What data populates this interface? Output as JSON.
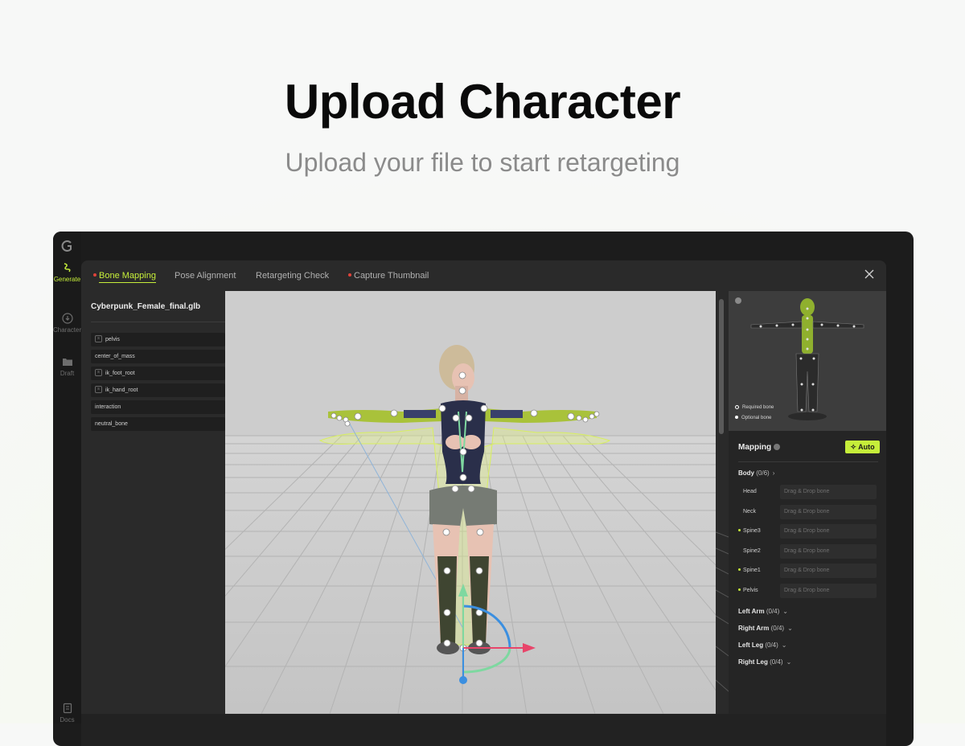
{
  "hero": {
    "title": "Upload Character",
    "subtitle": "Upload your file to start retargeting"
  },
  "sidebar": {
    "items": [
      {
        "label": "Generate",
        "icon": "squiggle-icon",
        "active": true
      },
      {
        "label": "Character",
        "icon": "download-circle-icon",
        "active": false
      },
      {
        "label": "Draft",
        "icon": "folder-icon",
        "active": false
      },
      {
        "label": "Docs",
        "icon": "document-icon",
        "active": false
      }
    ]
  },
  "tabs": [
    {
      "label": "Bone Mapping",
      "active": true,
      "alert": true
    },
    {
      "label": "Pose Alignment",
      "active": false,
      "alert": false
    },
    {
      "label": "Retargeting Check",
      "active": false,
      "alert": false
    },
    {
      "label": "Capture Thumbnail",
      "active": false,
      "alert": true
    }
  ],
  "file": {
    "name": "Cyberpunk_Female_final.glb",
    "bones": [
      {
        "label": "pelvis",
        "has_icon": true
      },
      {
        "label": "center_of_mass",
        "has_icon": false
      },
      {
        "label": "ik_foot_root",
        "has_icon": true
      },
      {
        "label": "ik_hand_root",
        "has_icon": true
      },
      {
        "label": "interaction",
        "has_icon": false
      },
      {
        "label": "neutral_bone",
        "has_icon": false
      }
    ]
  },
  "preview": {
    "legend": {
      "required": "Required bone",
      "optional": "Optional bone"
    }
  },
  "mapping": {
    "title": "Mapping",
    "auto_label": "Auto",
    "placeholder": "Drag & Drop bone",
    "body": {
      "label": "Body",
      "count": "(0/6)",
      "slots": [
        {
          "label": "Head",
          "required": false
        },
        {
          "label": "Neck",
          "required": false
        },
        {
          "label": "Spine3",
          "required": true
        },
        {
          "label": "Spine2",
          "required": false
        },
        {
          "label": "Spine1",
          "required": true
        },
        {
          "label": "Pelvis",
          "required": true
        }
      ]
    },
    "groups": [
      {
        "label": "Left Arm",
        "count": "(0/4)"
      },
      {
        "label": "Right Arm",
        "count": "(0/4)"
      },
      {
        "label": "Left Leg",
        "count": "(0/4)"
      },
      {
        "label": "Right Leg",
        "count": "(0/4)"
      }
    ]
  },
  "colors": {
    "accent": "#c6ee3a",
    "alert": "#e0433a",
    "axis_x": "#e8456a",
    "axis_y": "#7ed8a0",
    "axis_z": "#3b8fe0"
  }
}
